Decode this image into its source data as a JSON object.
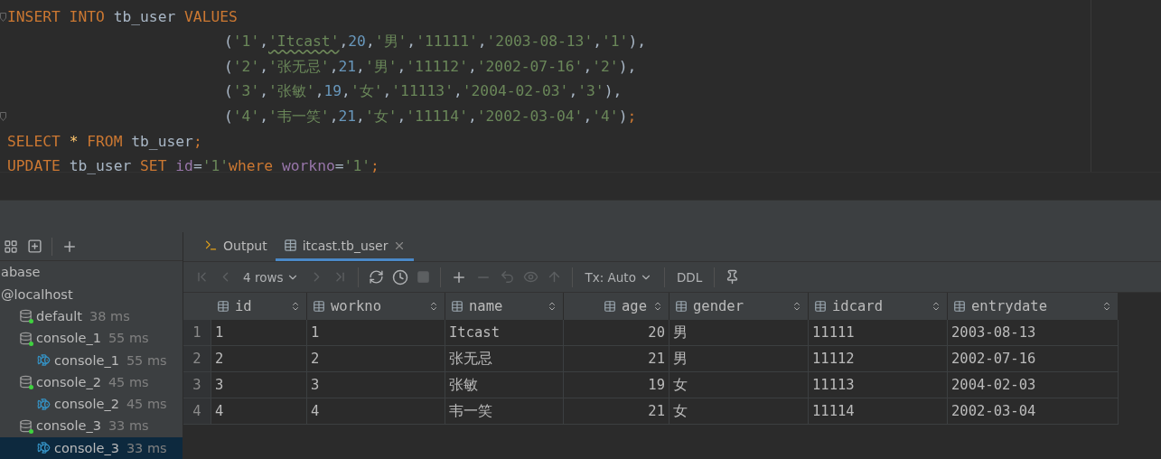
{
  "editor": {
    "lines": [
      {
        "kind": "statement",
        "fold": true,
        "tokens": [
          {
            "kind": "keyword",
            "text": "INSERT INTO "
          },
          {
            "kind": "ident",
            "text": "tb_user "
          },
          {
            "kind": "keyword",
            "text": "VALUES"
          }
        ]
      },
      {
        "kind": "continuation",
        "fold": false,
        "tokens": [
          {
            "kind": "punct",
            "text": "("
          },
          {
            "kind": "string",
            "text": "'1'"
          },
          {
            "kind": "punct",
            "text": ","
          },
          {
            "kind": "string",
            "text": "'Itcast'",
            "typo": true
          },
          {
            "kind": "punct",
            "text": ","
          },
          {
            "kind": "number",
            "text": "20"
          },
          {
            "kind": "punct",
            "text": ","
          },
          {
            "kind": "string",
            "text": "'男'"
          },
          {
            "kind": "punct",
            "text": ","
          },
          {
            "kind": "string",
            "text": "'11111'"
          },
          {
            "kind": "punct",
            "text": ","
          },
          {
            "kind": "string",
            "text": "'2003-08-13'"
          },
          {
            "kind": "punct",
            "text": ","
          },
          {
            "kind": "string",
            "text": "'1'"
          },
          {
            "kind": "punct",
            "text": "),"
          }
        ]
      },
      {
        "kind": "continuation",
        "fold": false,
        "tokens": [
          {
            "kind": "punct",
            "text": "("
          },
          {
            "kind": "string",
            "text": "'2'"
          },
          {
            "kind": "punct",
            "text": ","
          },
          {
            "kind": "string",
            "text": "'张无忌'"
          },
          {
            "kind": "punct",
            "text": ","
          },
          {
            "kind": "number",
            "text": "21"
          },
          {
            "kind": "punct",
            "text": ","
          },
          {
            "kind": "string",
            "text": "'男'"
          },
          {
            "kind": "punct",
            "text": ","
          },
          {
            "kind": "string",
            "text": "'11112'"
          },
          {
            "kind": "punct",
            "text": ","
          },
          {
            "kind": "string",
            "text": "'2002-07-16'"
          },
          {
            "kind": "punct",
            "text": ","
          },
          {
            "kind": "string",
            "text": "'2'"
          },
          {
            "kind": "punct",
            "text": "),"
          }
        ]
      },
      {
        "kind": "continuation",
        "fold": false,
        "tokens": [
          {
            "kind": "punct",
            "text": "("
          },
          {
            "kind": "string",
            "text": "'3'"
          },
          {
            "kind": "punct",
            "text": ","
          },
          {
            "kind": "string",
            "text": "'张敏'"
          },
          {
            "kind": "punct",
            "text": ","
          },
          {
            "kind": "number",
            "text": "19"
          },
          {
            "kind": "punct",
            "text": ","
          },
          {
            "kind": "string",
            "text": "'女'"
          },
          {
            "kind": "punct",
            "text": ","
          },
          {
            "kind": "string",
            "text": "'11113'"
          },
          {
            "kind": "punct",
            "text": ","
          },
          {
            "kind": "string",
            "text": "'2004-02-03'"
          },
          {
            "kind": "punct",
            "text": ","
          },
          {
            "kind": "string",
            "text": "'3'"
          },
          {
            "kind": "punct",
            "text": "),"
          }
        ]
      },
      {
        "kind": "continuation",
        "fold": true,
        "tokens": [
          {
            "kind": "punct",
            "text": "("
          },
          {
            "kind": "string",
            "text": "'4'"
          },
          {
            "kind": "punct",
            "text": ","
          },
          {
            "kind": "string",
            "text": "'韦一笑'"
          },
          {
            "kind": "punct",
            "text": ","
          },
          {
            "kind": "number",
            "text": "21"
          },
          {
            "kind": "punct",
            "text": ","
          },
          {
            "kind": "string",
            "text": "'女'"
          },
          {
            "kind": "punct",
            "text": ","
          },
          {
            "kind": "string",
            "text": "'11114'"
          },
          {
            "kind": "punct",
            "text": ","
          },
          {
            "kind": "string",
            "text": "'2002-03-04'"
          },
          {
            "kind": "punct",
            "text": ","
          },
          {
            "kind": "string",
            "text": "'4'"
          },
          {
            "kind": "punct",
            "text": ")"
          },
          {
            "kind": "keyword",
            "text": ";"
          }
        ]
      },
      {
        "kind": "statement",
        "fold": false,
        "tokens": [
          {
            "kind": "keyword",
            "text": "SELECT "
          },
          {
            "kind": "star",
            "text": "*"
          },
          {
            "kind": "keyword",
            "text": " FROM "
          },
          {
            "kind": "ident",
            "text": "tb_user"
          },
          {
            "kind": "keyword",
            "text": ";"
          }
        ]
      },
      {
        "kind": "statement",
        "fold": false,
        "tokens": [
          {
            "kind": "keyword",
            "text": "UPDATE "
          },
          {
            "kind": "ident",
            "text": "tb_user "
          },
          {
            "kind": "keyword",
            "text": "SET "
          },
          {
            "kind": "column",
            "text": "id"
          },
          {
            "kind": "punct",
            "text": "="
          },
          {
            "kind": "string",
            "text": "'1'"
          },
          {
            "kind": "keyword",
            "text": "where "
          },
          {
            "kind": "column",
            "text": "workno"
          },
          {
            "kind": "punct",
            "text": "="
          },
          {
            "kind": "string",
            "text": "'1'"
          },
          {
            "kind": "keyword",
            "text": ";"
          }
        ]
      }
    ]
  },
  "sidebar": {
    "tree": [
      {
        "label": "abase",
        "selected": false
      },
      {
        "label": "@localhost",
        "selected": false,
        "children": [
          {
            "label": "default",
            "time": "38 ms",
            "kind": "session",
            "selected": false
          },
          {
            "label": "console_1",
            "time": "55 ms",
            "kind": "session",
            "selected": false,
            "children": [
              {
                "label": "console_1",
                "time": "55 ms",
                "kind": "console",
                "selected": false
              }
            ]
          },
          {
            "label": "console_2",
            "time": "45 ms",
            "kind": "session",
            "selected": false,
            "children": [
              {
                "label": "console_2",
                "time": "45 ms",
                "kind": "console",
                "selected": false
              }
            ]
          },
          {
            "label": "console_3",
            "time": "33 ms",
            "kind": "session",
            "selected": false,
            "children": [
              {
                "label": "console_3",
                "time": "33 ms",
                "kind": "console",
                "selected": true
              }
            ]
          }
        ]
      }
    ]
  },
  "tabs": [
    {
      "label": "Output",
      "kind": "output",
      "selected": false,
      "closable": false
    },
    {
      "label": "itcast.tb_user",
      "kind": "table",
      "selected": true,
      "closable": true
    }
  ],
  "toolbar": {
    "rows": "4 rows",
    "tx": "Tx: Auto",
    "ddl": "DDL"
  },
  "table": {
    "columns": [
      {
        "label": "id",
        "kind": "text"
      },
      {
        "label": "workno",
        "kind": "text"
      },
      {
        "label": "name",
        "kind": "text"
      },
      {
        "label": "age",
        "kind": "numeric"
      },
      {
        "label": "gender",
        "kind": "text"
      },
      {
        "label": "idcard",
        "kind": "text"
      },
      {
        "label": "entrydate",
        "kind": "text"
      }
    ],
    "rows": [
      {
        "number": "1",
        "cells": [
          "1",
          "1",
          "Itcast",
          "20",
          "男",
          "11111",
          "2003-08-13"
        ]
      },
      {
        "number": "2",
        "cells": [
          "2",
          "2",
          "张无忌",
          "21",
          "男",
          "11112",
          "2002-07-16"
        ]
      },
      {
        "number": "3",
        "cells": [
          "3",
          "3",
          "张敏",
          "19",
          "女",
          "11113",
          "2004-02-03"
        ]
      },
      {
        "number": "4",
        "cells": [
          "4",
          "4",
          "韦一笑",
          "21",
          "女",
          "11114",
          "2002-03-04"
        ]
      }
    ]
  }
}
